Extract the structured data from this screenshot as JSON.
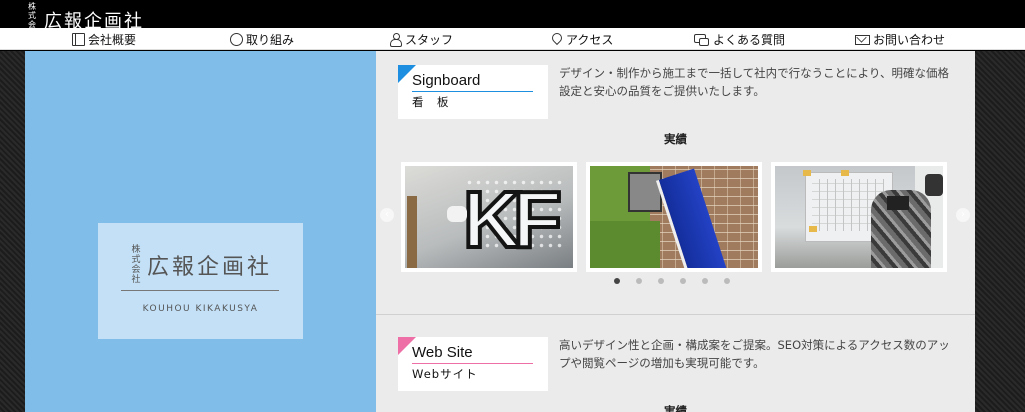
{
  "header": {
    "logo_kabu": "株式会社",
    "logo_name": "広報企画社"
  },
  "nav": {
    "items": [
      {
        "label": "会社概要",
        "icon": "book-icon"
      },
      {
        "label": "取り組み",
        "icon": "circle-icon"
      },
      {
        "label": "スタッフ",
        "icon": "person-icon"
      },
      {
        "label": "アクセス",
        "icon": "map-pin-icon"
      },
      {
        "label": "よくある質問",
        "icon": "chat-bubbles-icon"
      },
      {
        "label": "お問い合わせ",
        "icon": "envelope-icon"
      }
    ]
  },
  "hero": {
    "kabu": "株式会社",
    "title": "広報企画社",
    "subtitle": "KOUHOU KIKAKUSYA",
    "bg_color": "#80bde9"
  },
  "services": [
    {
      "name_en": "Signboard",
      "name_jp": "看　板",
      "accent": "#1e8fe0",
      "description": "デザイン・制作から施工まで一括して社内で行なうことにより、明確な価格設定と安心の品質をご提供いたします。",
      "results_heading": "実績",
      "carousel": {
        "slides": [
          "signboard-photo-letters",
          "signboard-photo-blue-board",
          "signboard-photo-installation"
        ],
        "dots": 6,
        "active_dot": 1,
        "prev_icon": "‹",
        "next_icon": "›"
      }
    },
    {
      "name_en": "Web Site",
      "name_jp": "Webサイト",
      "accent": "#ee6fa5",
      "description": "高いデザイン性と企画・構成案をご提案。SEO対策によるアクセス数のアップや閲覧ページの増加も実現可能です。",
      "results_heading": "実績"
    }
  ]
}
